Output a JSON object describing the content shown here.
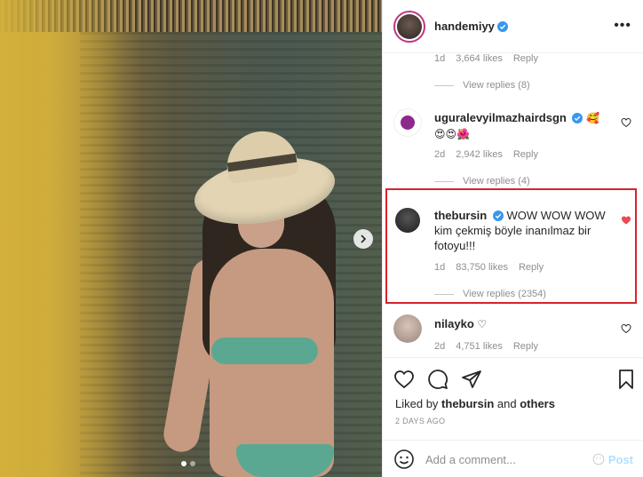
{
  "post": {
    "username": "handemiyy",
    "more_icon": "more-horizontal-icon",
    "image_dots": 2,
    "active_dot": 0
  },
  "comments": [
    {
      "meta_likes": "3,664 likes",
      "meta_time": "1d",
      "reply_label": "Reply",
      "view_replies": "View replies (8)"
    },
    {
      "username": "uguralevyilmazhairdsgn",
      "text": "🥰",
      "text2": "😍😍🌺",
      "meta_time": "2d",
      "meta_likes": "2,942 likes",
      "reply_label": "Reply",
      "view_replies": "View replies (4)"
    },
    {
      "username": "thebursin",
      "text": "WOW WOW WOW kim çekmiş böyle inanılmaz bir fotoyu!!!",
      "meta_time": "1d",
      "meta_likes": "83,750 likes",
      "reply_label": "Reply",
      "view_replies": "View replies (2354)",
      "liked": true
    },
    {
      "username": "nilayko",
      "text": "♡",
      "meta_time": "2d",
      "meta_likes": "4,751 likes",
      "reply_label": "Reply"
    }
  ],
  "actions": {
    "liked_by_prefix": "Liked by",
    "liked_by_user": "thebursin",
    "liked_by_and": "and",
    "liked_by_others": "others",
    "time_ago": "2 DAYS AGO"
  },
  "add_comment": {
    "placeholder": "Add a comment...",
    "post_label": "Post"
  },
  "colors": {
    "verified": "#3897f0",
    "liked_heart": "#ed4956",
    "highlight_border": "#d9232e",
    "post_button": "#b2dffc"
  }
}
